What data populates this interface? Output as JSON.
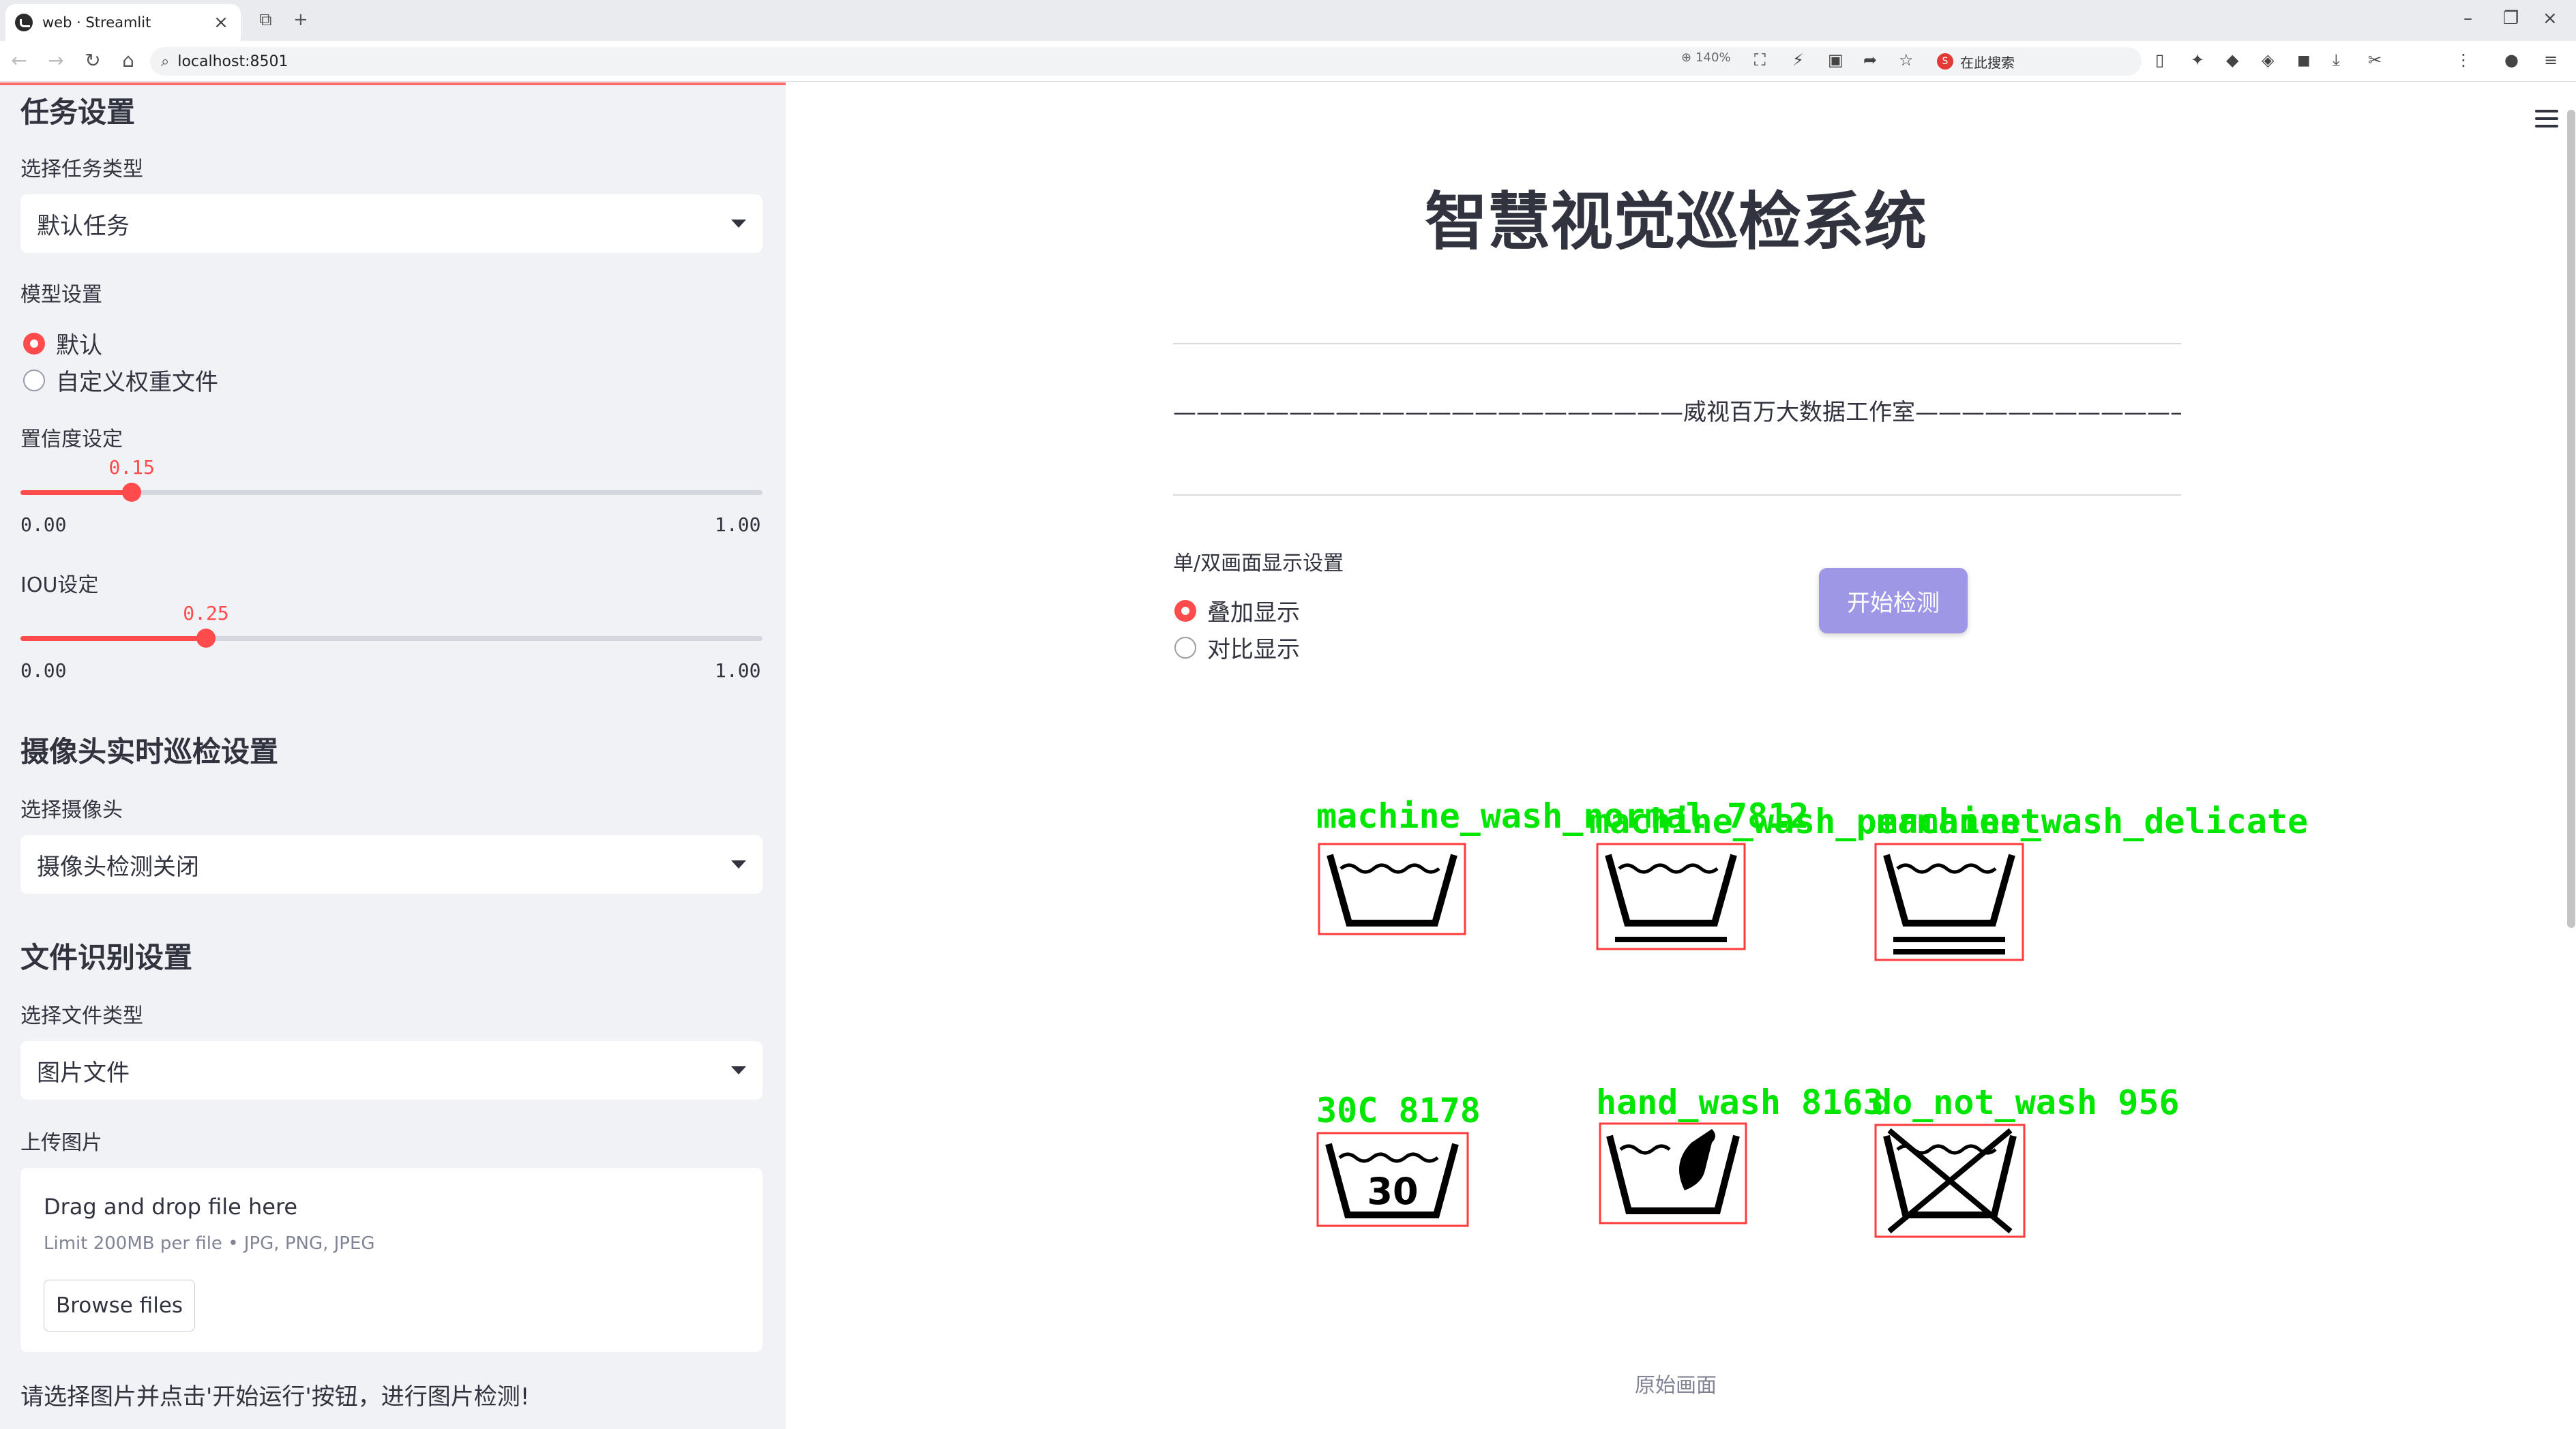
{
  "browser": {
    "tab_title": "web · Streamlit",
    "url": "localhost:8501",
    "zoom": "140%",
    "search_engine_label": "在此搜索"
  },
  "sidebar": {
    "task_header": "任务设置",
    "task_type_label": "选择任务类型",
    "task_type_value": "默认任务",
    "model_label": "模型设置",
    "model_options": [
      "默认",
      "自定义权重文件"
    ],
    "model_selected": 0,
    "conf": {
      "label": "置信度设定",
      "value": 0.15,
      "value_text": "0.15",
      "min": "0.00",
      "max": "1.00"
    },
    "iou": {
      "label": "IOU设定",
      "value": 0.25,
      "value_text": "0.25",
      "min": "0.00",
      "max": "1.00"
    },
    "camera_header": "摄像头实时巡检设置",
    "camera_label": "选择摄像头",
    "camera_value": "摄像头检测关闭",
    "file_header": "文件识别设置",
    "file_type_label": "选择文件类型",
    "file_type_value": "图片文件",
    "upload_label": "上传图片",
    "uploader": {
      "title": "Drag and drop file here",
      "subtitle": "Limit 200MB per file • JPG, PNG, JPEG",
      "button": "Browse files"
    },
    "note": "请选择图片并点击'开始运行'按钮，进行图片检测!"
  },
  "main": {
    "title": "智慧视觉巡检系统",
    "subtitle": "——————————————————————威视百万大数据工作室——————————————————————",
    "display_label": "单/双画面显示设置",
    "display_options": [
      "叠加显示",
      "对比显示"
    ],
    "display_selected": 0,
    "start_button": "开始检测",
    "caption": "原始画面",
    "detections": [
      {
        "label": "machine_wash_normal 7812",
        "symbol": "wash-tub"
      },
      {
        "label": "machine_wash_permanent",
        "symbol": "wash-tub-1bar"
      },
      {
        "label": "machine_wash_delicate",
        "symbol": "wash-tub-2bar"
      },
      {
        "label": "30C 8178",
        "symbol": "wash-30"
      },
      {
        "label": "hand_wash 8163",
        "symbol": "hand-wash"
      },
      {
        "label": "do_not_wash 956",
        "symbol": "no-wash"
      }
    ],
    "colors": {
      "box": "#ff3b3b",
      "label": "#00e600",
      "accent": "#ff4b4b",
      "button": "#9d97e6"
    }
  }
}
